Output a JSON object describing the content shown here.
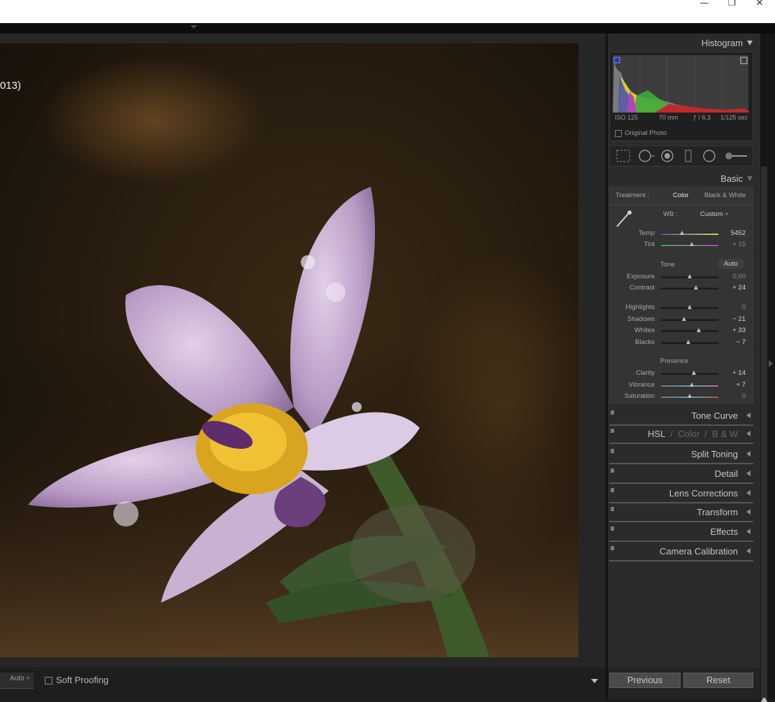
{
  "window": {
    "minimize_icon": "minimize-icon",
    "restore_icon": "restore-icon",
    "close_icon": "close-icon",
    "minimize": "—",
    "restore": "❐",
    "close": "✕"
  },
  "photo": {
    "caption": "013)"
  },
  "histogram": {
    "title": "Histogram",
    "iso": "ISO 125",
    "focal": "70 mm",
    "aperture": "ƒ / 6,3",
    "shutter": "1/125 sec",
    "original_photo": "Original Photo"
  },
  "basic": {
    "title": "Basic",
    "treatment_label": "Treatment :",
    "treatment_color": "Color",
    "treatment_bw": "Black & White",
    "wb_label": "WB :",
    "wb_value": "Custom ÷",
    "sliders_wb": [
      {
        "label": "Temp",
        "value": "5452",
        "pos": 0.37
      },
      {
        "label": "Tint",
        "value": "+ 15",
        "pos": 0.54
      }
    ],
    "tone_label": "Tone",
    "auto_label": "Auto",
    "sliders_tone1": [
      {
        "label": "Exposure",
        "value": "0,00",
        "pos": 0.5
      },
      {
        "label": "Contrast",
        "value": "+ 24",
        "pos": 0.61
      }
    ],
    "sliders_tone2": [
      {
        "label": "Highlights",
        "value": "0",
        "pos": 0.5
      },
      {
        "label": "Shadows",
        "value": "− 21",
        "pos": 0.4
      },
      {
        "label": "Whites",
        "value": "+ 33",
        "pos": 0.66
      },
      {
        "label": "Blacks",
        "value": "− 7",
        "pos": 0.47
      }
    ],
    "presence_label": "Presence",
    "sliders_presence": [
      {
        "label": "Clarity",
        "value": "+ 14",
        "pos": 0.57
      },
      {
        "label": "Vibrance",
        "value": "+ 7",
        "pos": 0.54
      },
      {
        "label": "Saturation",
        "value": "0",
        "pos": 0.5
      }
    ]
  },
  "collapsed_panels": [
    "Tone Curve",
    "HSL",
    "Split Toning",
    "Detail",
    "Lens Corrections",
    "Transform",
    "Effects",
    "Camera Calibration"
  ],
  "hsl_extra": {
    "sep": "/",
    "color": "Color",
    "bw": "B & W"
  },
  "toolbar": {
    "auto_label": "Auto ÷",
    "soft_proofing": "Soft Proofing"
  },
  "buttons": {
    "previous": "Previous",
    "reset": "Reset"
  },
  "colors": {
    "panel_bg": "#2b2b2b",
    "section_bg": "#343434",
    "text_light": "#c8c8c8"
  }
}
